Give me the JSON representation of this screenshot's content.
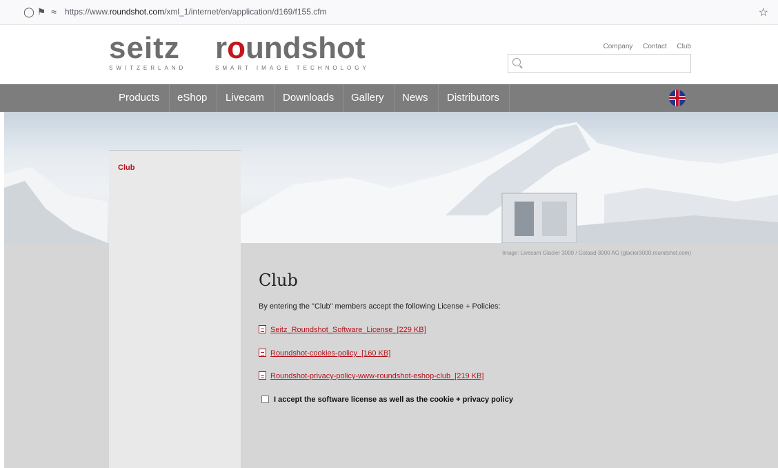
{
  "browser": {
    "url_prefix": "https://www.",
    "url_domain": "roundshot.com",
    "url_path": "/xml_1/internet/en/application/d169/f155.cfm"
  },
  "header": {
    "logo_seitz": "seitz",
    "logo_seitz_tag": "SWITZERLAND",
    "logo_round_pre": "r",
    "logo_round_o": "o",
    "logo_round_post": "undshot",
    "logo_round_tag": "SMART IMAGE TECHNOLOGY",
    "toplinks": [
      "Company",
      "Contact",
      "Club"
    ],
    "search_placeholder": ""
  },
  "nav": {
    "items": [
      "Products",
      "eShop",
      "Livecam",
      "Downloads",
      "Gallery",
      "News",
      "Distributors"
    ],
    "language_icon": "uk-flag-icon"
  },
  "sidebar": {
    "active_link": "Club"
  },
  "banner": {
    "caption": "Image: Livecam Glacier 3000 / Gstaad 3000 AG (glacier3000.roundshot.com)"
  },
  "main": {
    "title": "Club",
    "intro": "By entering the \"Club\" members accept the following License + Policies:",
    "documents": [
      "Seitz_Roundshot_Software_License_[229 KB]",
      "Roundshot-cookies-policy_[160 KB]",
      "Roundshot-privacy-policy-www-roundshot-eshop-club_[219 KB]"
    ],
    "accept_label": "I accept the software license as well as the cookie + privacy policy"
  },
  "colors": {
    "brand_red": "#b4121b",
    "nav_gray": "#7d7d7d",
    "content_gray": "#d6d6d6"
  }
}
